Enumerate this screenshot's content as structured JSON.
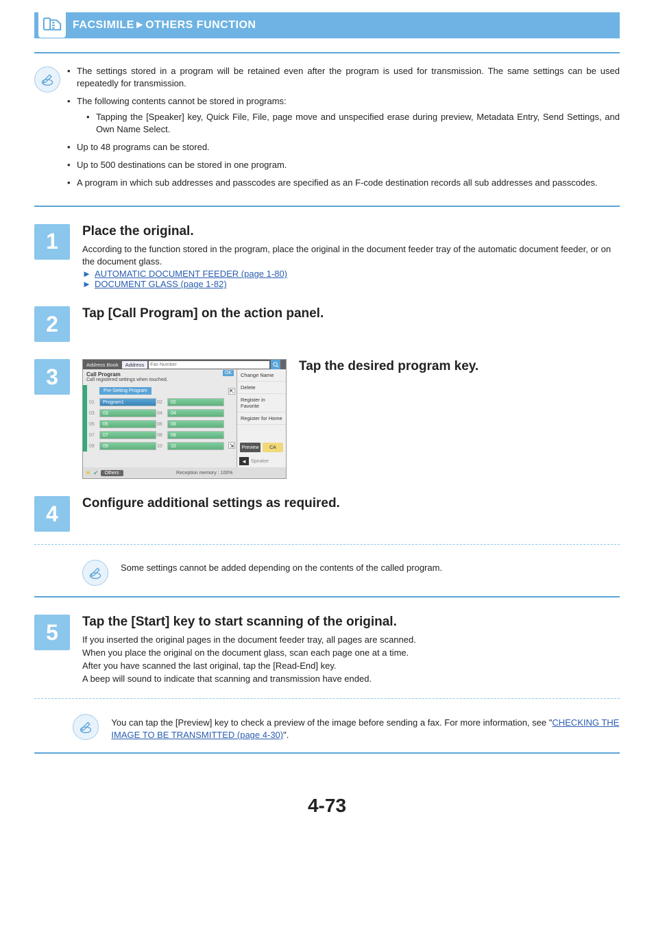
{
  "header": {
    "breadcrumb": "FACSIMILE►OTHERS FUNCTION"
  },
  "infoBullets": {
    "b1": "The settings stored in a program will be retained even after the program is used for transmission. The same settings can be used repeatedly for transmission.",
    "b2": "The following contents cannot be stored in programs:",
    "b2a": "Tapping the [Speaker] key, Quick File, File, page move and unspecified erase during preview, Metadata Entry, Send Settings, and Own Name Select.",
    "b3": "Up to 48 programs can be stored.",
    "b4": "Up to 500 destinations can be stored in one program.",
    "b5": "A program in which sub addresses and passcodes are specified as an F-code destination records all sub addresses and passcodes."
  },
  "steps": {
    "s1num": "1",
    "s1title": "Place the original.",
    "s1text": "According to the function stored in the program, place the original in the document feeder tray of the automatic document feeder, or on the document glass.",
    "s1link1": "AUTOMATIC DOCUMENT FEEDER (page 1-80)",
    "s1link2": "DOCUMENT GLASS (page 1-82)",
    "s2num": "2",
    "s2title": "Tap [Call Program] on the action panel.",
    "s3num": "3",
    "s3title": "Tap the desired program key.",
    "s4num": "4",
    "s4title": "Configure additional settings as required.",
    "s4note": "Some settings cannot be added depending on the contents of the called program.",
    "s5num": "5",
    "s5title": "Tap the [Start] key to start scanning of the original.",
    "s5l1": "If you inserted the original pages in the document feeder tray, all pages are scanned.",
    "s5l2": "When you place the original on the document glass, scan each page one at a time.",
    "s5l3": "After you have scanned the last original, tap the [Read-End] key.",
    "s5l4": "A beep will sound to indicate that scanning and transmission have ended.",
    "s5notePre": "You can tap the [Preview] key to check a preview of the image before sending a fax. For more information, see \"",
    "s5noteLink": "CHECKING THE IMAGE TO BE TRANSMITTED (page 4-30)",
    "s5notePost": "\"."
  },
  "screenshot": {
    "tabAddrBook": "Address Book",
    "tabAddress": "Address",
    "faxPlaceholder": "Fax Number",
    "panelTitle": "Call Program",
    "panelSub": "Call registered settings when touched.",
    "ok": "OK",
    "preSetting": "Pre-Setting Program",
    "rows": [
      {
        "n1": "01",
        "l1": "Program1",
        "n2": "02",
        "l2": "02"
      },
      {
        "n1": "03",
        "l1": "03",
        "n2": "04",
        "l2": "04"
      },
      {
        "n1": "05",
        "l1": "05",
        "n2": "06",
        "l2": "06"
      },
      {
        "n1": "07",
        "l1": "07",
        "n2": "08",
        "l2": "08"
      },
      {
        "n1": "09",
        "l1": "09",
        "n2": "10",
        "l2": "10"
      }
    ],
    "side": {
      "changeName": "Change Name",
      "delete": "Delete",
      "regFav": "Register in Favorite",
      "regHome": "Register for Home"
    },
    "preview": "Preview",
    "ca": "CA",
    "others": "Others",
    "memory": "Reception memory :",
    "memVal": "100%",
    "speaker": "Speaker"
  },
  "pageNumber": "4-73"
}
